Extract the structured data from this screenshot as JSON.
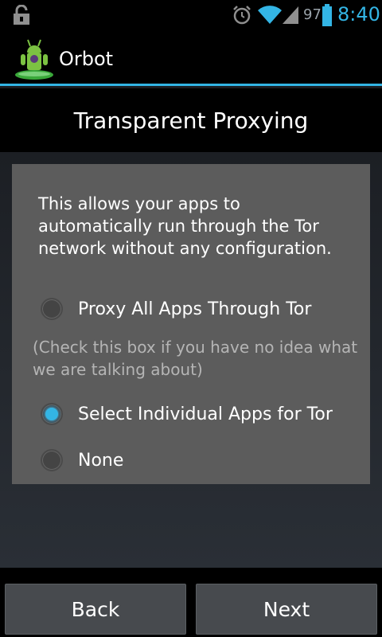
{
  "status_bar": {
    "battery_percent": "97",
    "time": "8:40",
    "icons": [
      "lock-icon",
      "alarm-icon",
      "wifi-icon",
      "signal-icon",
      "battery-icon"
    ]
  },
  "action_bar": {
    "app_title": "Orbot",
    "logo_icon": "orbot-logo-icon",
    "accent_color": "#33b5e5"
  },
  "header": {
    "title": "Transparent Proxying"
  },
  "panel": {
    "description": "This allows your apps to automatically run through the Tor network without any configuration.",
    "hint": "(Check this box if you have no idea what we are talking about)",
    "options": [
      {
        "label": "Proxy All Apps Through Tor",
        "checked": false
      },
      {
        "label": "Select Individual Apps for Tor",
        "checked": true
      },
      {
        "label": "None",
        "checked": false
      }
    ]
  },
  "buttons": {
    "back": "Back",
    "next": "Next"
  }
}
